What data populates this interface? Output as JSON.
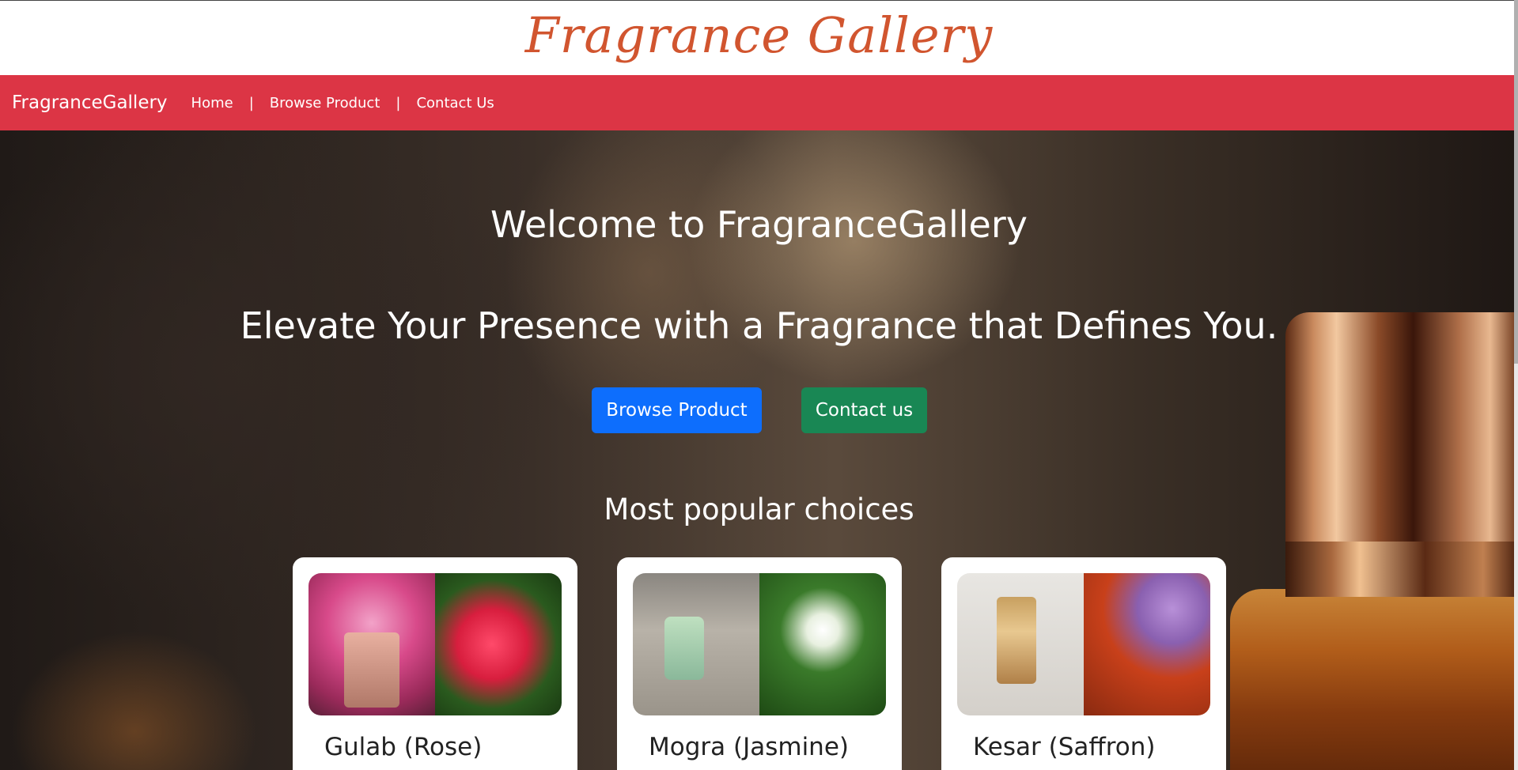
{
  "site": {
    "logo_title": "Fragrance Gallery"
  },
  "navbar": {
    "brand": "FragranceGallery",
    "links": [
      {
        "label": "Home"
      },
      {
        "label": "Browse Product"
      },
      {
        "label": "Contact Us"
      }
    ],
    "separator": "|",
    "bg_color": "#dc3545"
  },
  "hero": {
    "welcome": "Welcome to FragranceGallery",
    "tagline": "Elevate Your Presence with a Fragrance that Defines You.",
    "buttons": {
      "browse": "Browse Product",
      "contact": "Contact us"
    },
    "popular_heading": "Most popular choices"
  },
  "products": [
    {
      "name": "Gulab (Rose)"
    },
    {
      "name": "Mogra (Jasmine)"
    },
    {
      "name": "Kesar (Saffron)"
    }
  ],
  "colors": {
    "accent_logo": "#d1552f",
    "browse_button": "#0d6efd",
    "contact_button": "#198754"
  }
}
